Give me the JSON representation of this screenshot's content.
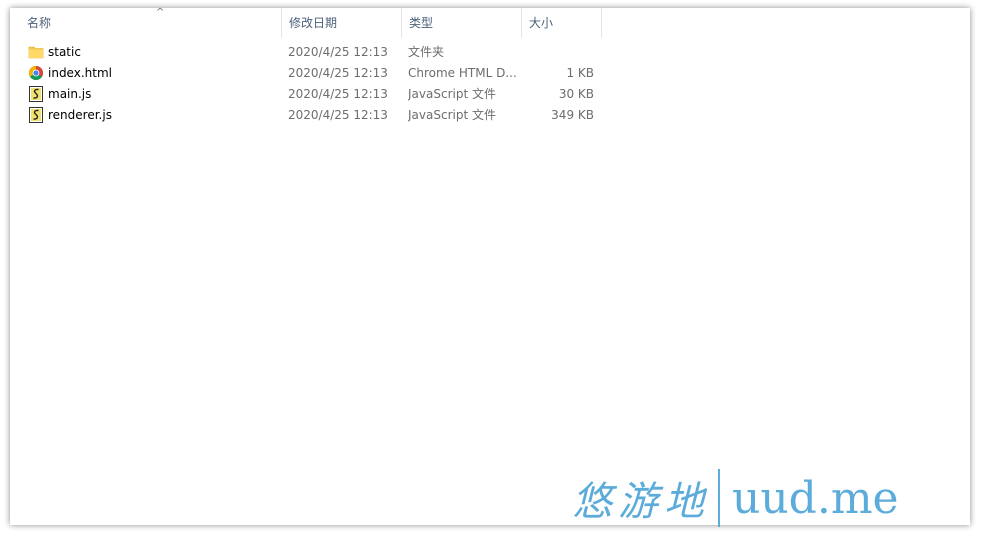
{
  "columns": {
    "name": "名称",
    "date": "修改日期",
    "type": "类型",
    "size": "大小"
  },
  "sort_indicator": "^",
  "files": [
    {
      "name": "static",
      "date": "2020/4/25 12:13",
      "type": "文件夹",
      "size": "",
      "icon": "folder-icon"
    },
    {
      "name": "index.html",
      "date": "2020/4/25 12:13",
      "type": "Chrome HTML D...",
      "size": "1 KB",
      "icon": "chrome-icon"
    },
    {
      "name": "main.js",
      "date": "2020/4/25 12:13",
      "type": "JavaScript 文件",
      "size": "30 KB",
      "icon": "javascript-file-icon"
    },
    {
      "name": "renderer.js",
      "date": "2020/4/25 12:13",
      "type": "JavaScript 文件",
      "size": "349 KB",
      "icon": "javascript-file-icon"
    }
  ],
  "watermark": {
    "chinese": "悠游地",
    "domain": "uud.me"
  },
  "colors": {
    "header_text": "#4c607a",
    "watermark": "#4aa3d8",
    "folder": "#f5c94a"
  }
}
